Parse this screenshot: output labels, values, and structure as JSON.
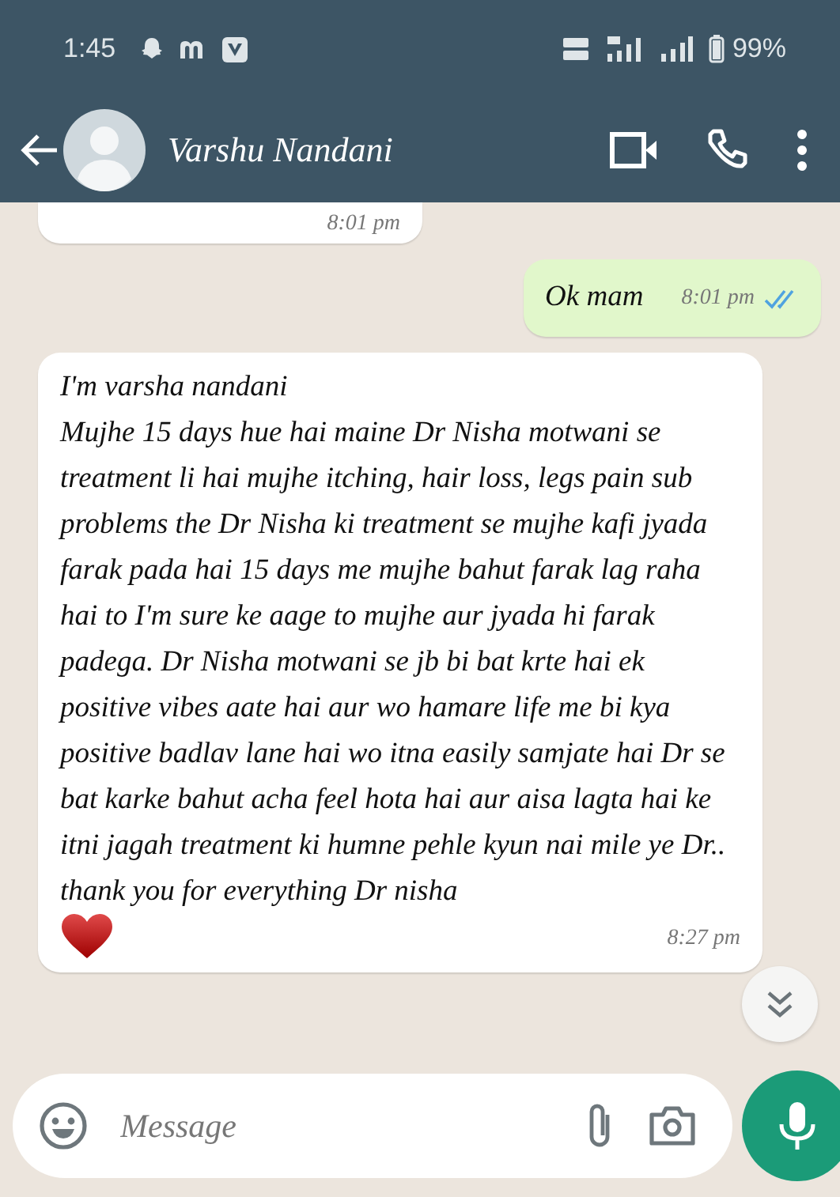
{
  "status_bar": {
    "time": "1:45",
    "battery": "99%"
  },
  "header": {
    "contact": "Varshu Nandani"
  },
  "messages": [
    {
      "kind": "incoming",
      "time": "8:01 pm"
    },
    {
      "kind": "outgoing",
      "text": "Ok mam",
      "time": "8:01 pm",
      "read": true
    },
    {
      "kind": "incoming",
      "text": "I'm varsha nandani\nMujhe 15 days hue hai maine Dr Nisha motwani se treatment li hai mujhe itching, hair loss, legs pain sub problems the Dr Nisha ki treatment se mujhe kafi jyada farak pada hai 15 days me mujhe bahut farak lag raha hai to I'm sure ke aage to mujhe aur jyada hi farak padega. Dr Nisha motwani se jb bi bat krte hai ek positive vibes aate hai aur wo hamare life me bi kya positive badlav lane hai wo itna easily samjate hai Dr se bat karke bahut acha feel hota hai aur aisa lagta hai ke itni jagah treatment ki humne pehle kyun nai mile ye Dr.. thank you for everything Dr nisha",
      "heart": true,
      "time": "8:27 pm"
    }
  ],
  "composer": {
    "placeholder": "Message"
  }
}
